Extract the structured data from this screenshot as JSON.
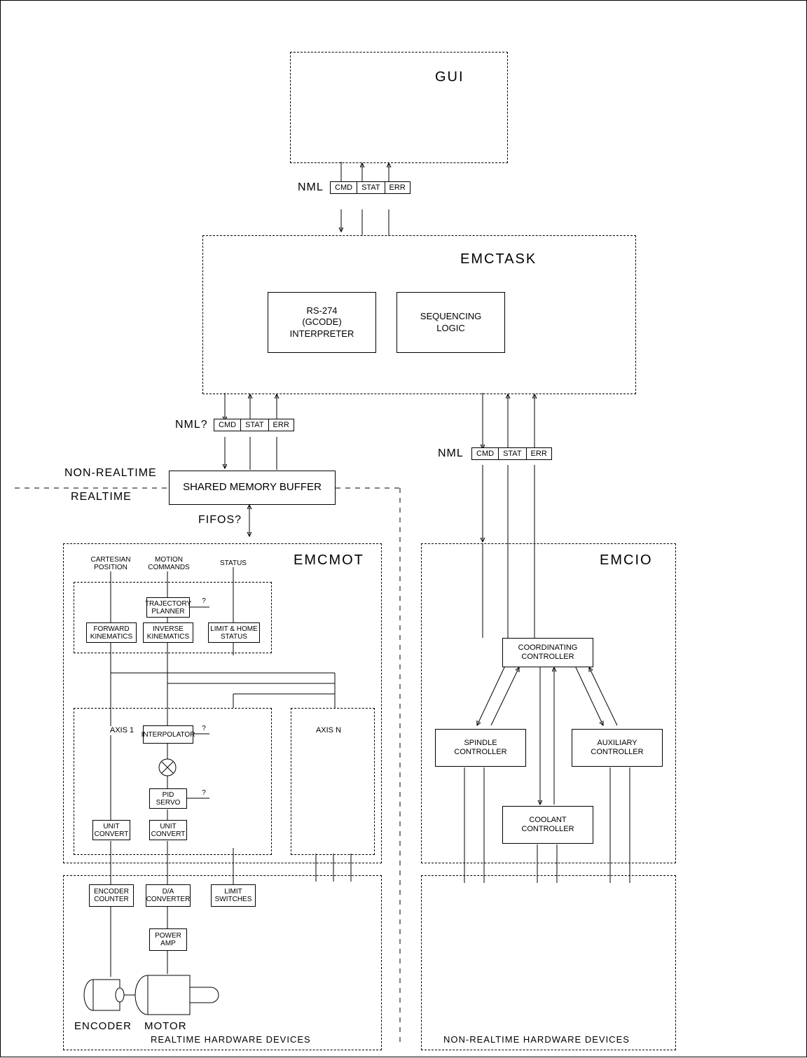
{
  "gui": "GUI",
  "emctask": {
    "title": "EMCTASK",
    "rs274": "RS-274\n(GCODE)\nINTERPRETER",
    "seq": "SEQUENCING\nLOGIC"
  },
  "nml": {
    "label": "NML",
    "label_q": "NML?",
    "cmd": "CMD",
    "stat": "STAT",
    "err": "ERR"
  },
  "shared_mem": "SHARED MEMORY BUFFER",
  "fifos": "FIFOS?",
  "non_rt": "NON-REALTIME",
  "rt": "REALTIME",
  "emcmot": {
    "title": "EMCMOT",
    "cart": "CARTESIAN\nPOSITION",
    "mot": "MOTION\nCOMMANDS",
    "status": "STATUS",
    "traj": "TRAJECTORY\nPLANNER",
    "fk": "FORWARD\nKINEMATICS",
    "ik": "INVERSE\nKINEMATICS",
    "lh": "LIMIT & HOME\nSTATUS",
    "q": "?",
    "axis1": "AXIS 1",
    "axisn": "AXIS N",
    "interp": "INTERPOLATOR",
    "pid": "PID\nSERVO",
    "uc": "UNIT\nCONVERT"
  },
  "hw": {
    "enc_cnt": "ENCODER\nCOUNTER",
    "dac": "D/A\nCONVERTER",
    "limit": "LIMIT\nSWITCHES",
    "pa": "POWER\nAMP",
    "enc": "ENCODER",
    "motor": "MOTOR",
    "rt_title": "REALTIME HARDWARE DEVICES",
    "nrt_title": "NON-REALTIME HARDWARE DEVICES"
  },
  "emcio": {
    "title": "EMCIO",
    "coord": "COORDINATING\nCONTROLLER",
    "spindle": "SPINDLE\nCONTROLLER",
    "coolant": "COOLANT\nCONTROLLER",
    "aux": "AUXILIARY\nCONTROLLER"
  }
}
